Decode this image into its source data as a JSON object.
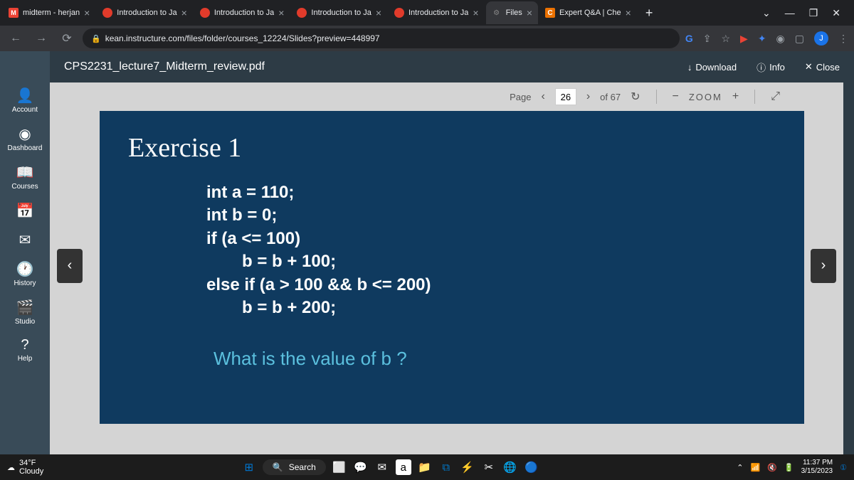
{
  "browser": {
    "tabs": [
      {
        "title": "midterm - herjan",
        "icon": "M"
      },
      {
        "title": "Introduction to Ja",
        "icon": "canvas"
      },
      {
        "title": "Introduction to Ja",
        "icon": "canvas"
      },
      {
        "title": "Introduction to Ja",
        "icon": "canvas"
      },
      {
        "title": "Introduction to Ja",
        "icon": "canvas"
      },
      {
        "title": "Files",
        "icon": "files",
        "active": true
      },
      {
        "title": "Expert Q&A | Che",
        "icon": "C"
      }
    ],
    "url": "kean.instructure.com/files/folder/courses_12224/Slides?preview=448997",
    "avatar": "J"
  },
  "doc": {
    "filename": "CPS2231_lecture7_Midterm_review.pdf",
    "download": "Download",
    "info": "Info",
    "close": "Close",
    "page_label": "Page",
    "page_current": "26",
    "page_total": "of 67",
    "zoom_label": "ZOOM"
  },
  "sidebar": {
    "account": "Account",
    "dashboard": "Dashboard",
    "courses": "Courses",
    "history": "History",
    "studio": "Studio",
    "help": "Help"
  },
  "slide": {
    "title": "Exercise 1",
    "code": {
      "l1": "int  a = 110;",
      "l2": "int b = 0;",
      "l3": "if (a <= 100)",
      "l4": "b = b + 100;",
      "l5": "else if (a > 100 && b <= 200)",
      "l6": "b = b + 200;"
    },
    "question": "What is the value of b ?"
  },
  "taskbar": {
    "temp": "34°F",
    "weather": "Cloudy",
    "search": "Search",
    "time": "11:37 PM",
    "date": "3/15/2023"
  }
}
